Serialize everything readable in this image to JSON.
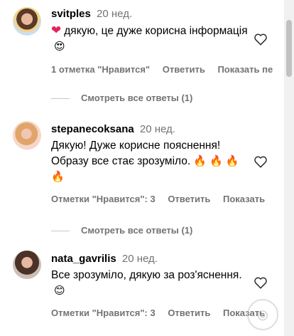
{
  "comments": [
    {
      "username": "svitples",
      "age": "20 нед.",
      "heart_emoji": "❤",
      "text": "дякую, це дуже корисна інформація",
      "emoji": "😍",
      "likes_label": "1 отметка \"Нравится\"",
      "reply_label": "Ответить",
      "show_label": "Показать пе",
      "view_replies": "Смотреть все ответы (1)"
    },
    {
      "username": "stepanecoksana",
      "age": "20 нед.",
      "text": "Дякую! Дуже корисне пояснення! Образу все стає зрозуміло.",
      "emoji": "🔥 🔥 🔥 🔥",
      "likes_label": "Отметки \"Нравится\": 3",
      "reply_label": "Ответить",
      "show_label": "Показать",
      "view_replies": "Смотреть все ответы (1)"
    },
    {
      "username": "nata_gavrilis",
      "age": "20 нед.",
      "text": "Все зрозуміло, дякую за роз'яснення.",
      "emoji": "😊",
      "likes_label": "Отметки \"Нравится\": 3",
      "reply_label": "Ответить",
      "show_label": "Показать"
    }
  ],
  "colors": {
    "text": "#000000",
    "secondary": "#737373",
    "heart": "#e3245c"
  },
  "icons": {
    "like": "heart-outline-icon",
    "avatar": "avatar"
  }
}
